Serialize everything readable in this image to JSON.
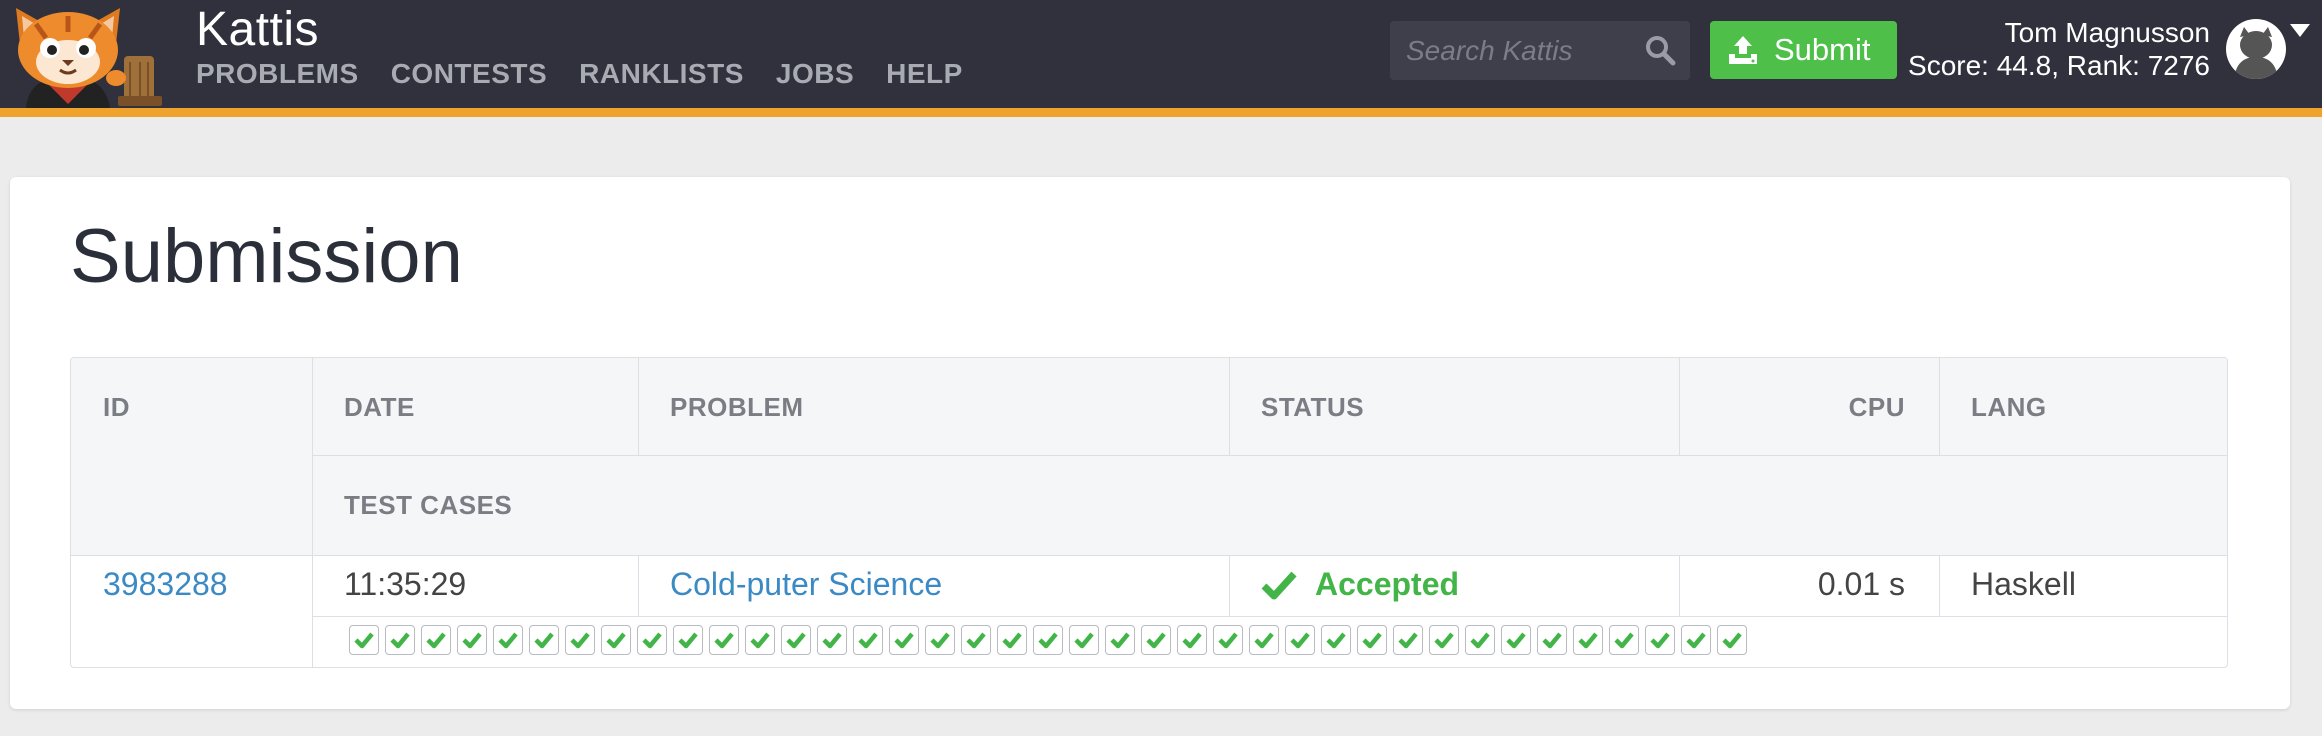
{
  "app": {
    "brand": "Kattis"
  },
  "nav": {
    "items": [
      {
        "label": "PROBLEMS"
      },
      {
        "label": "CONTESTS"
      },
      {
        "label": "RANKLISTS"
      },
      {
        "label": "JOBS"
      },
      {
        "label": "HELP"
      }
    ]
  },
  "search": {
    "placeholder": "Search Kattis",
    "icon": "search-icon"
  },
  "submit": {
    "label": "Submit",
    "icon": "upload-icon"
  },
  "user": {
    "name": "Tom Magnusson",
    "stats": "Score: 44.8, Rank: 7276"
  },
  "page": {
    "title": "Submission"
  },
  "table": {
    "headers": {
      "id": "ID",
      "date": "DATE",
      "problem": "PROBLEM",
      "status": "STATUS",
      "cpu": "CPU",
      "lang": "LANG",
      "test_cases": "TEST CASES"
    },
    "row": {
      "id": "3983288",
      "date": "11:35:29",
      "problem": "Cold-puter Science",
      "status": "Accepted",
      "cpu": "0.01 s",
      "lang": "Haskell"
    },
    "test_cases_passed": 39,
    "test_cases_total": 39
  },
  "colors": {
    "header_bg": "#30313c",
    "accent_orange": "#f0a32c",
    "submit_green": "#4ec04a",
    "accepted_green": "#43b548",
    "link_blue": "#3b8ac4"
  }
}
